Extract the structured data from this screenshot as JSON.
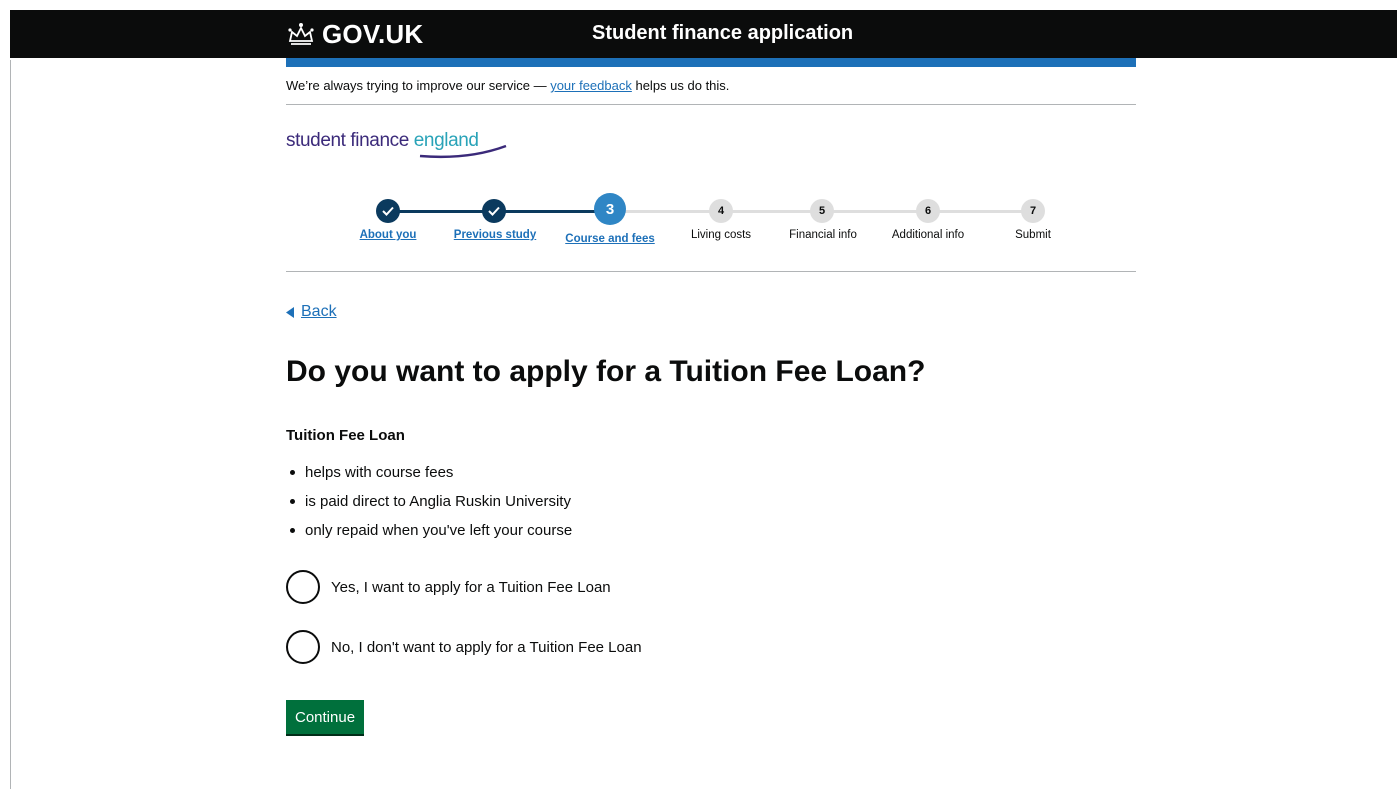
{
  "header": {
    "logo_text": "GOV.UK",
    "service_name": "Student finance application"
  },
  "feedback": {
    "prefix": "We’re always trying to improve our service — ",
    "link": "your feedback",
    "suffix": " helps us do this."
  },
  "brand": {
    "part1": "student finance ",
    "part2": "england"
  },
  "steps": [
    {
      "number": "1",
      "label": "About you",
      "status": "done"
    },
    {
      "number": "2",
      "label": "Previous study",
      "status": "done"
    },
    {
      "number": "3",
      "label": "Course and fees",
      "status": "current"
    },
    {
      "number": "4",
      "label": "Living costs",
      "status": "todo"
    },
    {
      "number": "5",
      "label": "Financial info",
      "status": "todo"
    },
    {
      "number": "6",
      "label": "Additional info",
      "status": "todo"
    },
    {
      "number": "7",
      "label": "Submit",
      "status": "todo"
    }
  ],
  "back_label": "Back",
  "title": "Do you want to apply for a Tuition Fee Loan?",
  "subheading": "Tuition Fee Loan",
  "bullets": [
    "helps with course fees",
    "is paid direct to Anglia Ruskin University",
    "only repaid when you've left your course"
  ],
  "options": [
    "Yes, I want to apply for a Tuition Fee Loan",
    "No, I don't want to apply for a Tuition Fee Loan"
  ],
  "continue_label": "Continue",
  "colors": {
    "header": "#0b0c0c",
    "blue_bar": "#1d70b8",
    "step_done": "#0b3a5e",
    "step_current": "#2f86c5",
    "step_todo": "#dedede",
    "button": "#00703c"
  }
}
